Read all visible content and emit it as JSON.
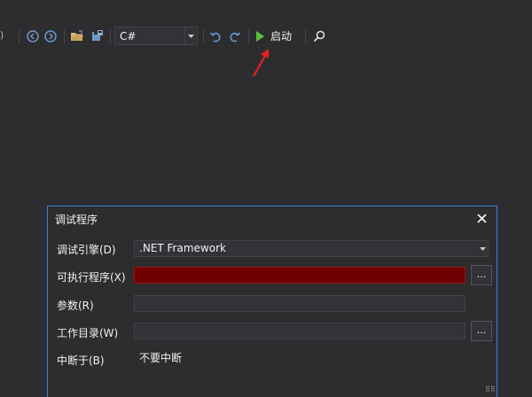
{
  "toolbar": {
    "edge_glyph": ")",
    "language": "C#",
    "start_label": "启动"
  },
  "dialog": {
    "title": "调试程序",
    "close_glyph": "✕",
    "rows": {
      "engine_label": "调试引擎(D)",
      "engine_value": ".NET Framework",
      "executable_label": "可执行程序(X)",
      "executable_value": "",
      "args_label": "参数(R)",
      "args_value": "",
      "workdir_label": "工作目录(W)",
      "workdir_value": "",
      "break_label": "中断于(B)",
      "break_value": "不要中断"
    },
    "browse_label": "..."
  },
  "colors": {
    "background": "#2d2d30",
    "accent_border": "#3f7fd3",
    "error_field": "#6e0000",
    "start_green": "#5bbf3c",
    "annotation_red": "#e8201c"
  },
  "icons": [
    "circle-back-icon",
    "circle-forward-icon",
    "open-folder-icon",
    "save-icon",
    "undo-icon",
    "redo-icon",
    "play-icon",
    "search-icon",
    "close-icon",
    "dropdown-arrow-icon"
  ]
}
